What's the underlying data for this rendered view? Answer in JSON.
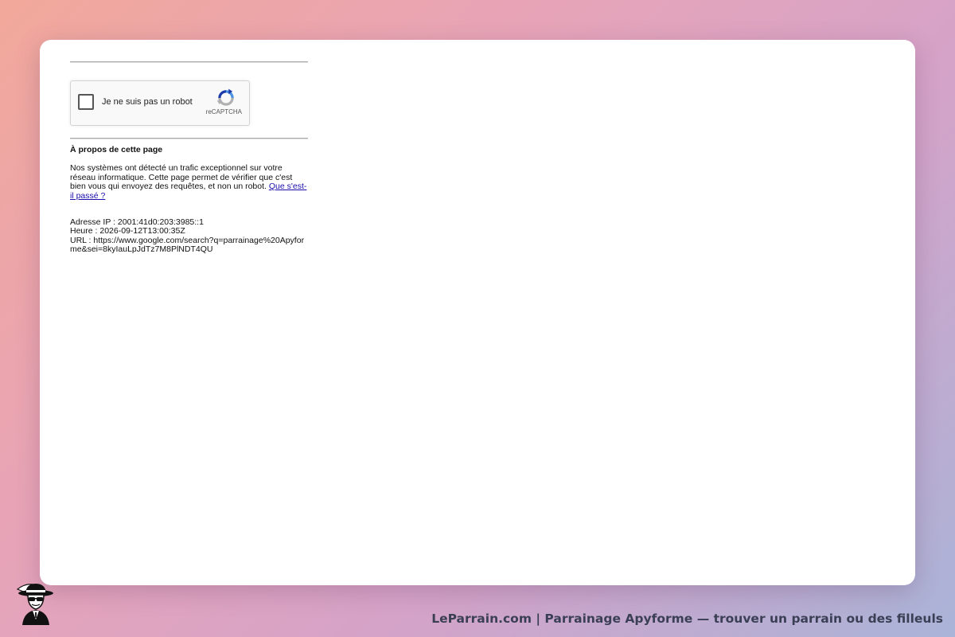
{
  "captcha": {
    "label": "Je ne suis pas un robot",
    "brand": "reCAPTCHA"
  },
  "about": {
    "title": "À propos de cette page",
    "text": "Nos systèmes ont détecté un trafic exceptionnel sur votre réseau informatique. Cette page permet de vérifier que c'est bien vous qui envoyez des requêtes, et non un robot.",
    "link": "Que s'est-il passé ?"
  },
  "meta": {
    "ip": "Adresse IP : 2001:41d0:203:3985::1",
    "time": "Heure : 2026-09-12T13:00:35Z",
    "url": "URL : https://www.google.com/search?q=parrainage%20Apyforme&sei=8kyIauLpJdTz7M8PlNDT4QU"
  },
  "footer": {
    "caption": "LeParrain.com | Parrainage Apyforme — trouver un parrain ou des filleuls"
  },
  "colors": {
    "link": "#1a0dab",
    "recaptcha_blue": "#4a90e2",
    "recaptcha_grey": "#b0b0b0",
    "footer_text": "#3b3f55"
  },
  "icons": {
    "captcha_logo": "recaptcha-logo-icon",
    "mascot": "mascot-gangster-icon"
  }
}
